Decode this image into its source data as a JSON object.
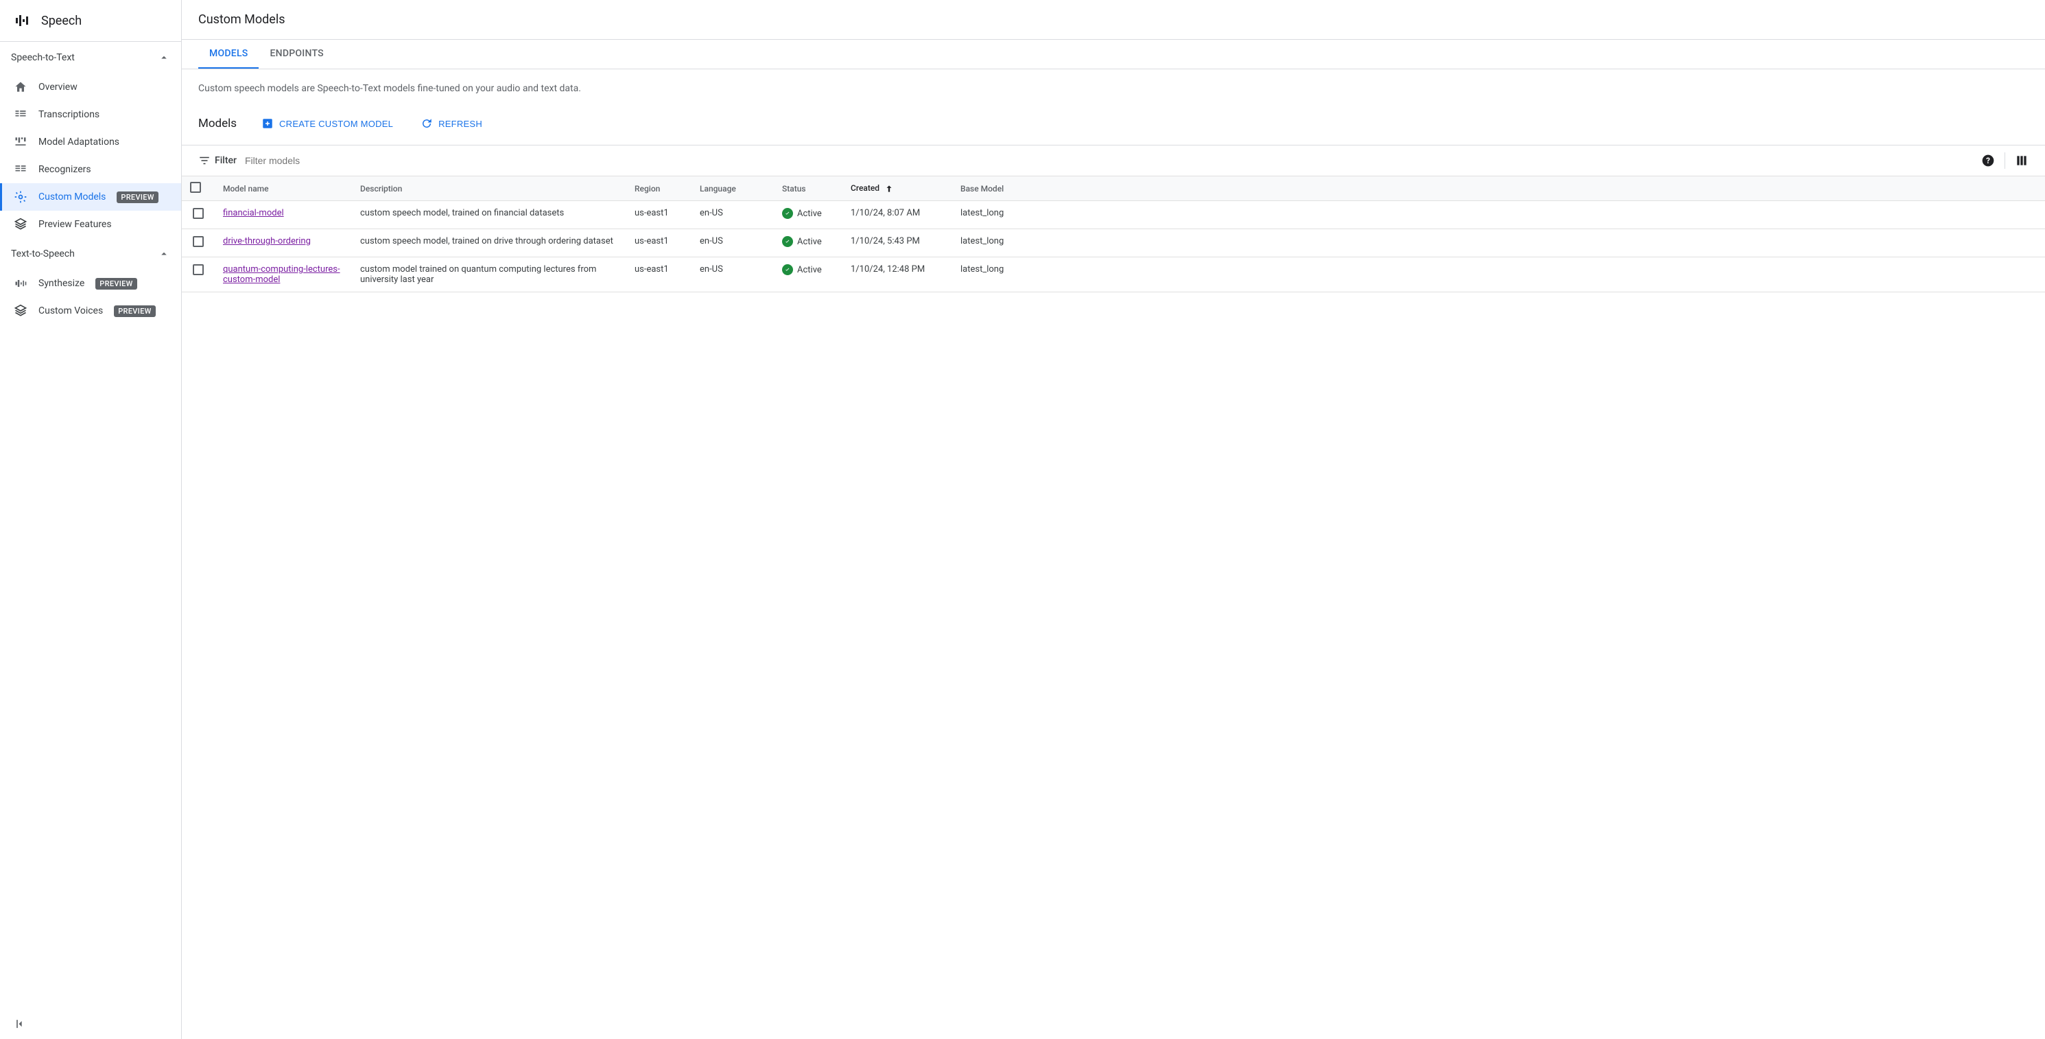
{
  "sidebar": {
    "title": "Speech",
    "sections": [
      {
        "header": "Speech-to-Text",
        "items": [
          {
            "label": "Overview",
            "icon": "home"
          },
          {
            "label": "Transcriptions",
            "icon": "transcriptions"
          },
          {
            "label": "Model Adaptations",
            "icon": "adaptations"
          },
          {
            "label": "Recognizers",
            "icon": "recognizers"
          },
          {
            "label": "Custom Models",
            "icon": "custom",
            "badge": "PREVIEW",
            "active": true
          },
          {
            "label": "Preview Features",
            "icon": "layers"
          }
        ]
      },
      {
        "header": "Text-to-Speech",
        "items": [
          {
            "label": "Synthesize",
            "icon": "synthesize",
            "badge": "PREVIEW"
          },
          {
            "label": "Custom Voices",
            "icon": "layers",
            "badge": "PREVIEW"
          }
        ]
      }
    ]
  },
  "page": {
    "title": "Custom Models",
    "tabs": [
      {
        "label": "MODELS",
        "active": true
      },
      {
        "label": "ENDPOINTS"
      }
    ],
    "description": "Custom speech models are Speech-to-Text models fine-tuned on your audio and text data.",
    "section_heading": "Models",
    "create_button": "CREATE CUSTOM MODEL",
    "refresh_button": "REFRESH",
    "filter_label": "Filter",
    "filter_placeholder": "Filter models",
    "columns": {
      "name": "Model name",
      "description": "Description",
      "region": "Region",
      "language": "Language",
      "status": "Status",
      "created": "Created",
      "base": "Base Model"
    },
    "rows": [
      {
        "name": "financial-model",
        "description": "custom speech model, trained on financial datasets",
        "region": "us-east1",
        "language": "en-US",
        "status": "Active",
        "created": "1/10/24, 8:07 AM",
        "base": "latest_long"
      },
      {
        "name": "drive-through-ordering",
        "description": "custom speech model, trained on drive through ordering dataset",
        "region": "us-east1",
        "language": "en-US",
        "status": "Active",
        "created": "1/10/24, 5:43 PM",
        "base": "latest_long"
      },
      {
        "name": "quantum-computing-lectures-custom-model",
        "description": "custom model trained on quantum computing lectures from university last year",
        "region": "us-east1",
        "language": "en-US",
        "status": "Active",
        "created": "1/10/24, 12:48 PM",
        "base": "latest_long"
      }
    ]
  }
}
